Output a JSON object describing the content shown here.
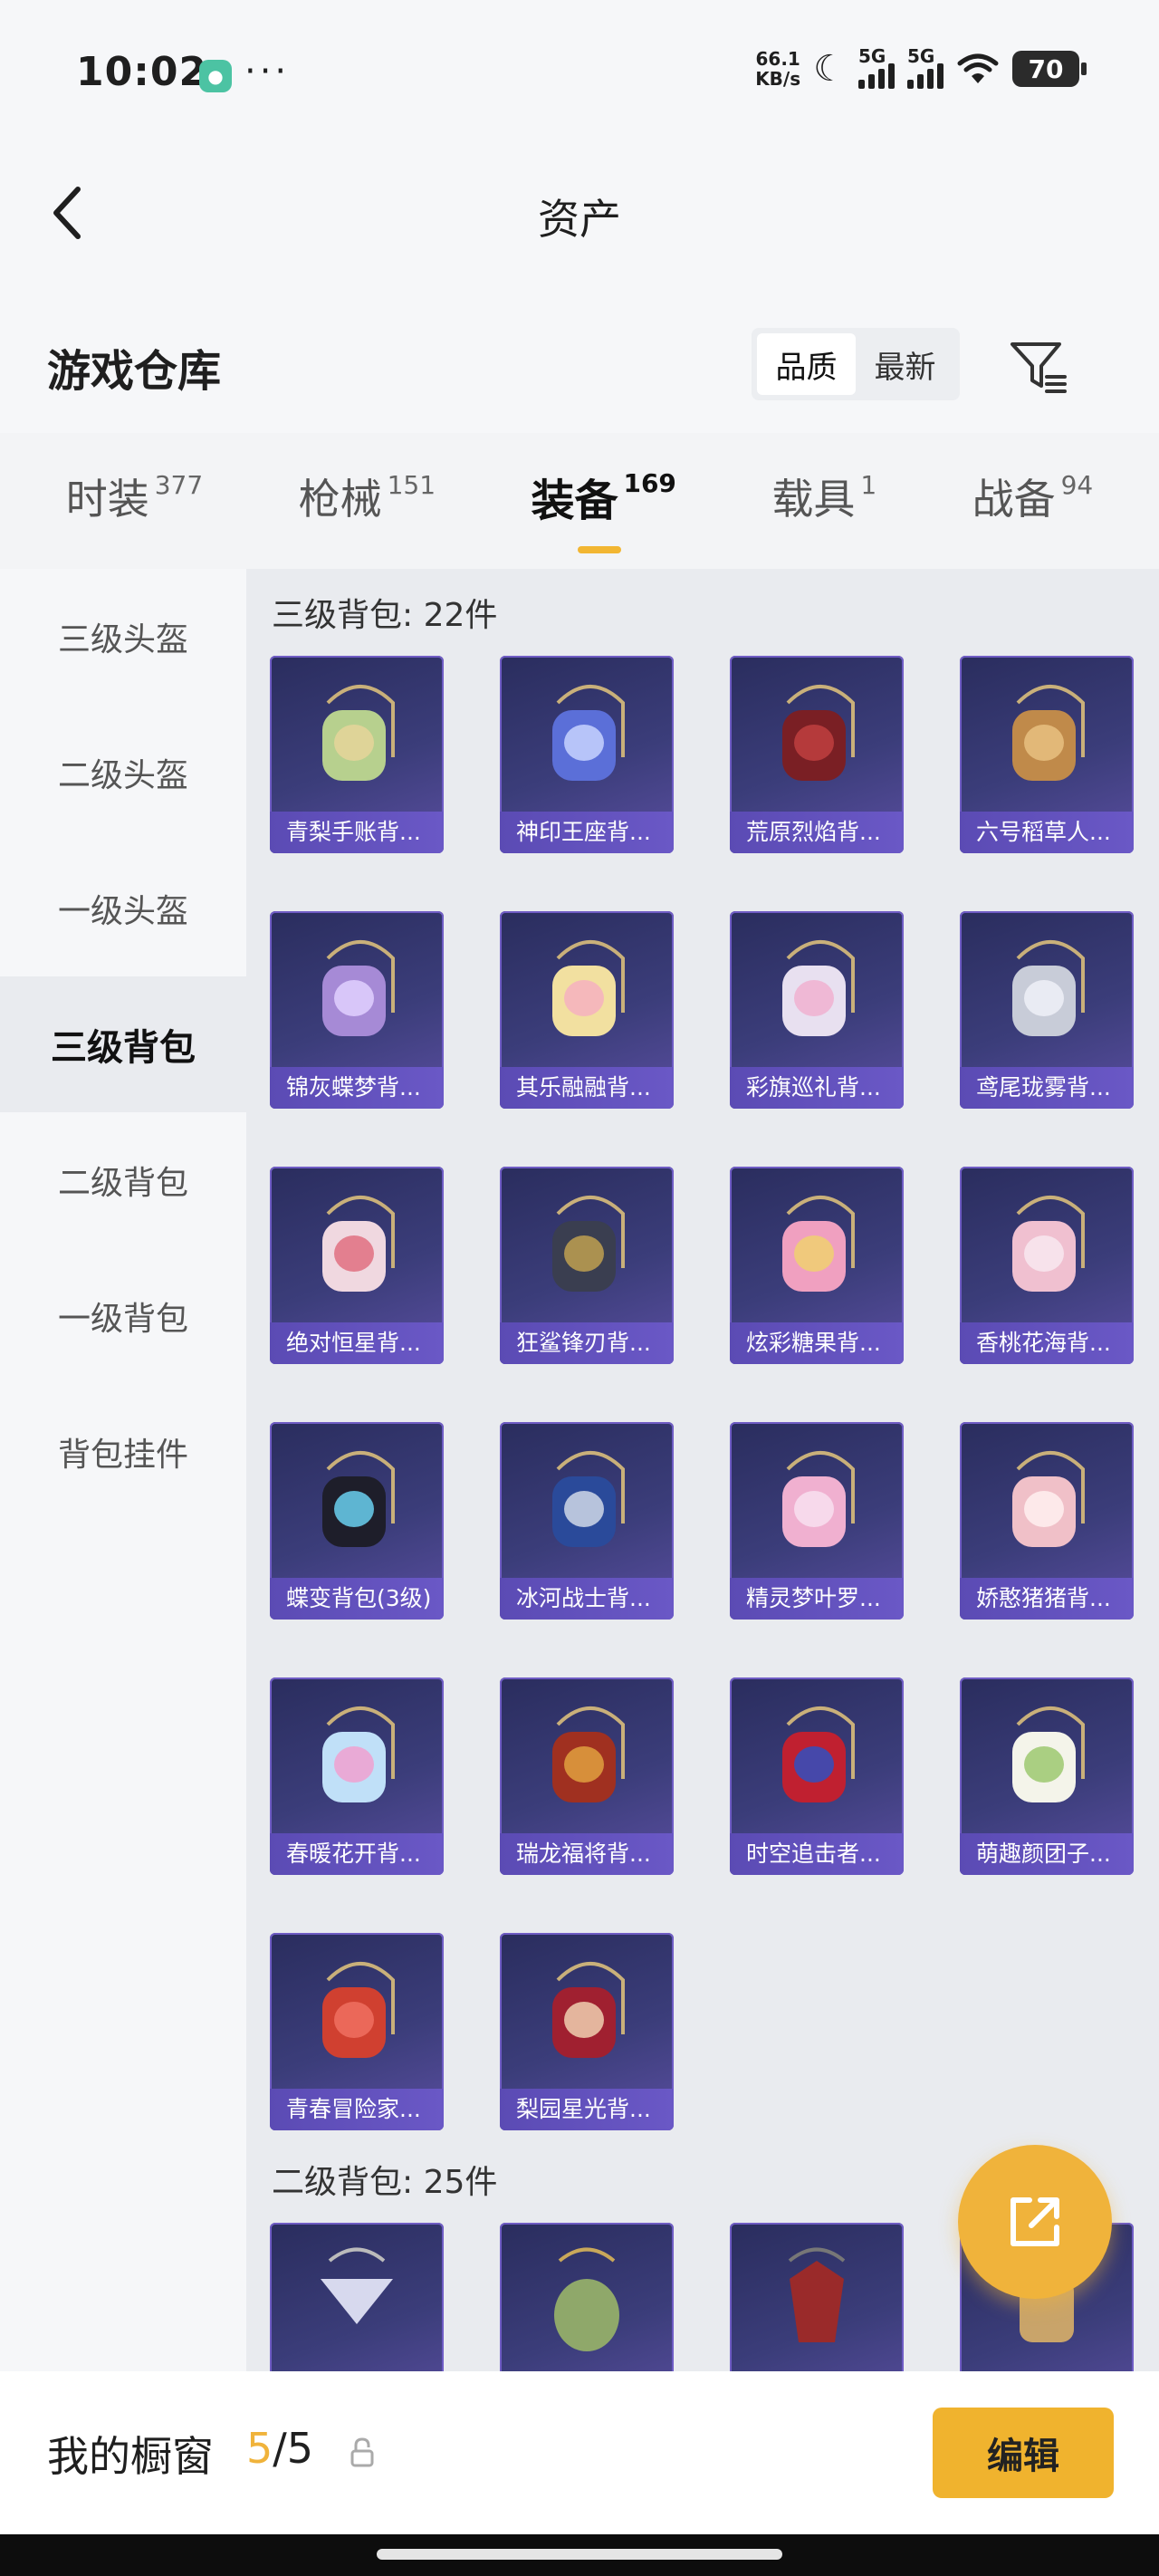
{
  "status_bar": {
    "time": "10:02",
    "net_speed_value": "66.1",
    "net_speed_unit": "KB/s",
    "signal1_tag": "5G",
    "signal2_tag": "5G",
    "battery": "70",
    "icons": [
      "wechat-icon",
      "more-dots-icon",
      "moon-icon",
      "signal-icon",
      "wifi-icon",
      "battery-icon"
    ]
  },
  "nav": {
    "title": "资产"
  },
  "warehouse": {
    "title": "游戏仓库",
    "sort_options": [
      "品质",
      "最新"
    ],
    "sort_selected": "品质"
  },
  "category_tabs": [
    {
      "label": "时装",
      "count": "377"
    },
    {
      "label": "枪械",
      "count": "151"
    },
    {
      "label": "装备",
      "count": "169"
    },
    {
      "label": "载具",
      "count": "1"
    },
    {
      "label": "战备",
      "count": "94"
    }
  ],
  "active_tab": "装备",
  "sidebar": [
    {
      "label": "三级头盔"
    },
    {
      "label": "二级头盔"
    },
    {
      "label": "一级头盔"
    },
    {
      "label": "三级背包"
    },
    {
      "label": "二级背包"
    },
    {
      "label": "一级背包"
    },
    {
      "label": "背包挂件"
    }
  ],
  "active_sidebar": "三级背包",
  "sections": [
    {
      "title": "三级背包: 22件",
      "items": [
        "青梨手账背...",
        "神印王座背...",
        "荒原烈焰背...",
        "六号稻草人...",
        "锦灰蝶梦背...",
        "其乐融融背...",
        "彩旗巡礼背...",
        "鸢尾珑雾背...",
        "绝对恒星背...",
        "狂鲨锋刃背...",
        "炫彩糖果背...",
        "香桃花海背...",
        "蝶变背包(3级)",
        "冰河战士背...",
        "精灵梦叶罗...",
        "娇憨猪猪背...",
        "春暖花开背...",
        "瑞龙福将背...",
        "时空追击者...",
        "萌趣颜团子...",
        "青春冒险家...",
        "梨园星光背..."
      ]
    },
    {
      "title": "二级背包: 25件",
      "items": []
    }
  ],
  "bottom_bar": {
    "label": "我的橱窗",
    "current": "5",
    "total": "/5",
    "edit_label": "编辑"
  },
  "colors": {
    "accent": "#f0b33b",
    "card_bg": "#3b3d7a",
    "card_label": "#6a58c6"
  }
}
